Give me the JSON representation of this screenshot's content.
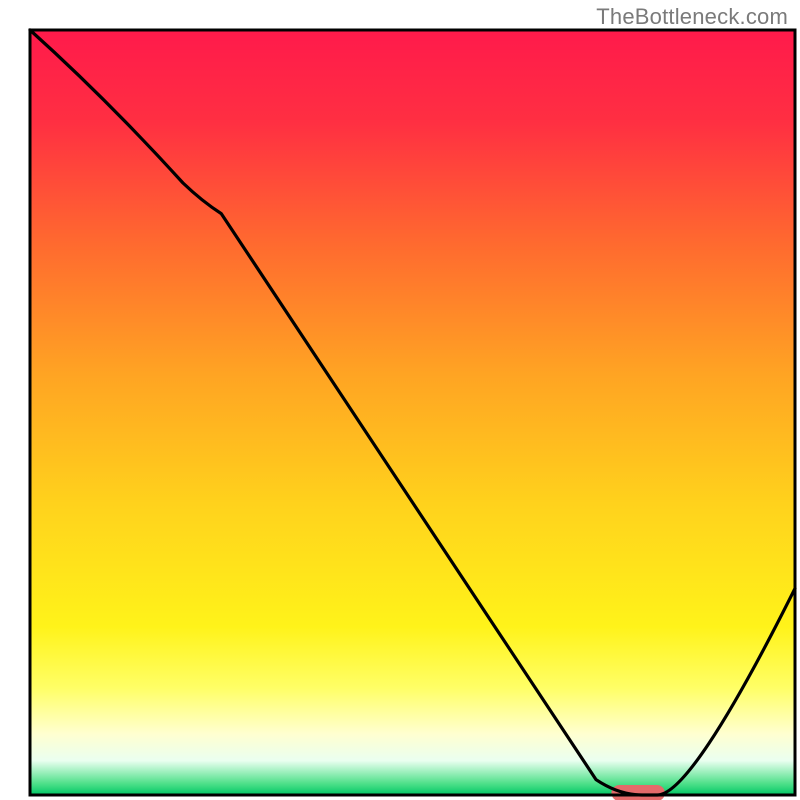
{
  "watermark": "TheBottleneck.com",
  "chart_data": {
    "type": "line",
    "title": "",
    "xlabel": "",
    "ylabel": "",
    "xlim": [
      0,
      100
    ],
    "ylim": [
      0,
      100
    ],
    "series": [
      {
        "name": "bottleneck-curve",
        "x": [
          0,
          20,
          25,
          74,
          80,
          82,
          100
        ],
        "values": [
          100,
          80,
          76,
          2,
          0,
          0,
          27
        ]
      }
    ],
    "marker": {
      "name": "optimal-range",
      "x_start": 76,
      "x_end": 83,
      "y": 0
    },
    "background_gradient": {
      "stops": [
        {
          "pos": 0.0,
          "color": "#ff1a4b"
        },
        {
          "pos": 0.12,
          "color": "#ff2f42"
        },
        {
          "pos": 0.28,
          "color": "#ff6a2f"
        },
        {
          "pos": 0.45,
          "color": "#ffa423"
        },
        {
          "pos": 0.62,
          "color": "#ffd21c"
        },
        {
          "pos": 0.78,
          "color": "#fff31a"
        },
        {
          "pos": 0.86,
          "color": "#ffff66"
        },
        {
          "pos": 0.92,
          "color": "#ffffd0"
        },
        {
          "pos": 0.955,
          "color": "#eafff0"
        },
        {
          "pos": 0.985,
          "color": "#4fe08a"
        },
        {
          "pos": 1.0,
          "color": "#00c765"
        }
      ]
    },
    "marker_color": "#e46a6a",
    "curve_color": "#000000",
    "frame_color": "#000000"
  }
}
